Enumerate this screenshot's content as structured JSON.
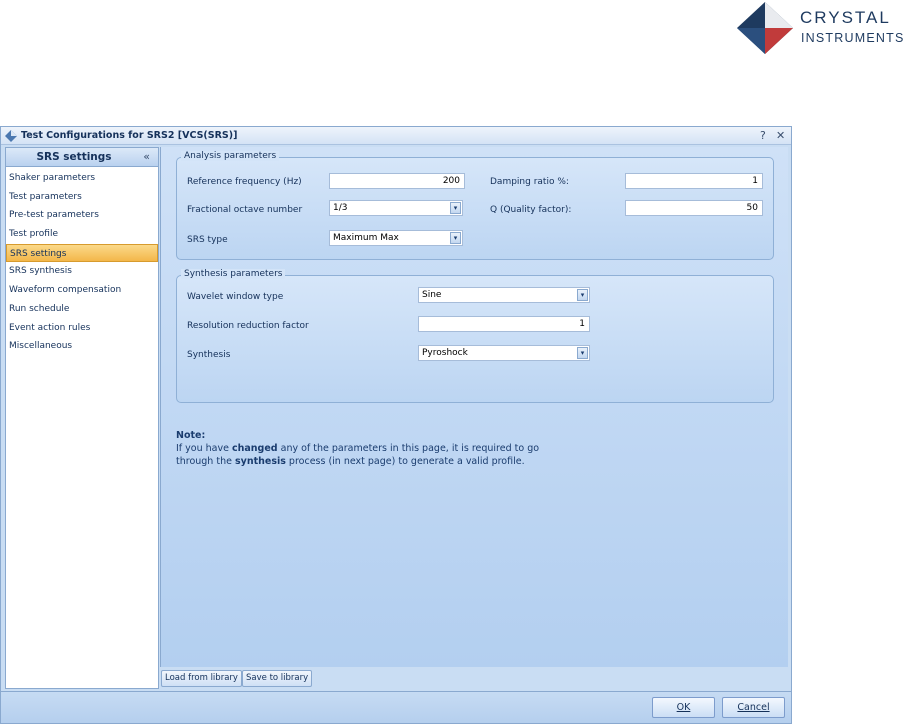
{
  "logo": {
    "line1": "CRYSTAL",
    "line2": "INSTRUMENTS"
  },
  "window": {
    "title": "Test Configurations for SRS2 [VCS(SRS)]",
    "help_glyph": "?",
    "close_glyph": "✕"
  },
  "sidebar": {
    "title": "SRS settings",
    "collapse_glyph": "«",
    "items": [
      {
        "label": "Shaker parameters"
      },
      {
        "label": "Test parameters"
      },
      {
        "label": "Pre-test parameters"
      },
      {
        "label": "Test profile"
      },
      {
        "label": "SRS settings"
      },
      {
        "label": "SRS synthesis"
      },
      {
        "label": "Waveform compensation"
      },
      {
        "label": "Run schedule"
      },
      {
        "label": "Event action rules"
      },
      {
        "label": "Miscellaneous"
      }
    ],
    "active_index": 4
  },
  "analysis": {
    "title": "Analysis parameters",
    "ref_freq_label": "Reference frequency (Hz)",
    "ref_freq_value": "200",
    "frac_octave_label": "Fractional octave number",
    "frac_octave_value": "1/3",
    "srs_type_label": "SRS type",
    "srs_type_value": "Maximum Max",
    "damping_label": "Damping ratio %:",
    "damping_value": "1",
    "q_label": "Q (Quality factor):",
    "q_value": "50"
  },
  "synthesis": {
    "title": "Synthesis parameters",
    "wavelet_label": "Wavelet window type",
    "wavelet_value": "Sine",
    "resolution_label": "Resolution reduction factor",
    "resolution_value": "1",
    "synthesis_label": "Synthesis",
    "synthesis_value": "Pyroshock"
  },
  "note": {
    "title": "Note:",
    "line1_pre": "If you have ",
    "line1_bold": "changed",
    "line1_post": " any of the parameters in this page, it is required to go",
    "line2_pre": "through the ",
    "line2_bold": "synthesis",
    "line2_post": " process (in next page) to generate a valid profile."
  },
  "library": {
    "load_label": "Load from library",
    "save_label": "Save to library"
  },
  "footer": {
    "ok_label": "OK",
    "cancel_label": "Cancel"
  },
  "combo_arrow_glyph": "▾"
}
